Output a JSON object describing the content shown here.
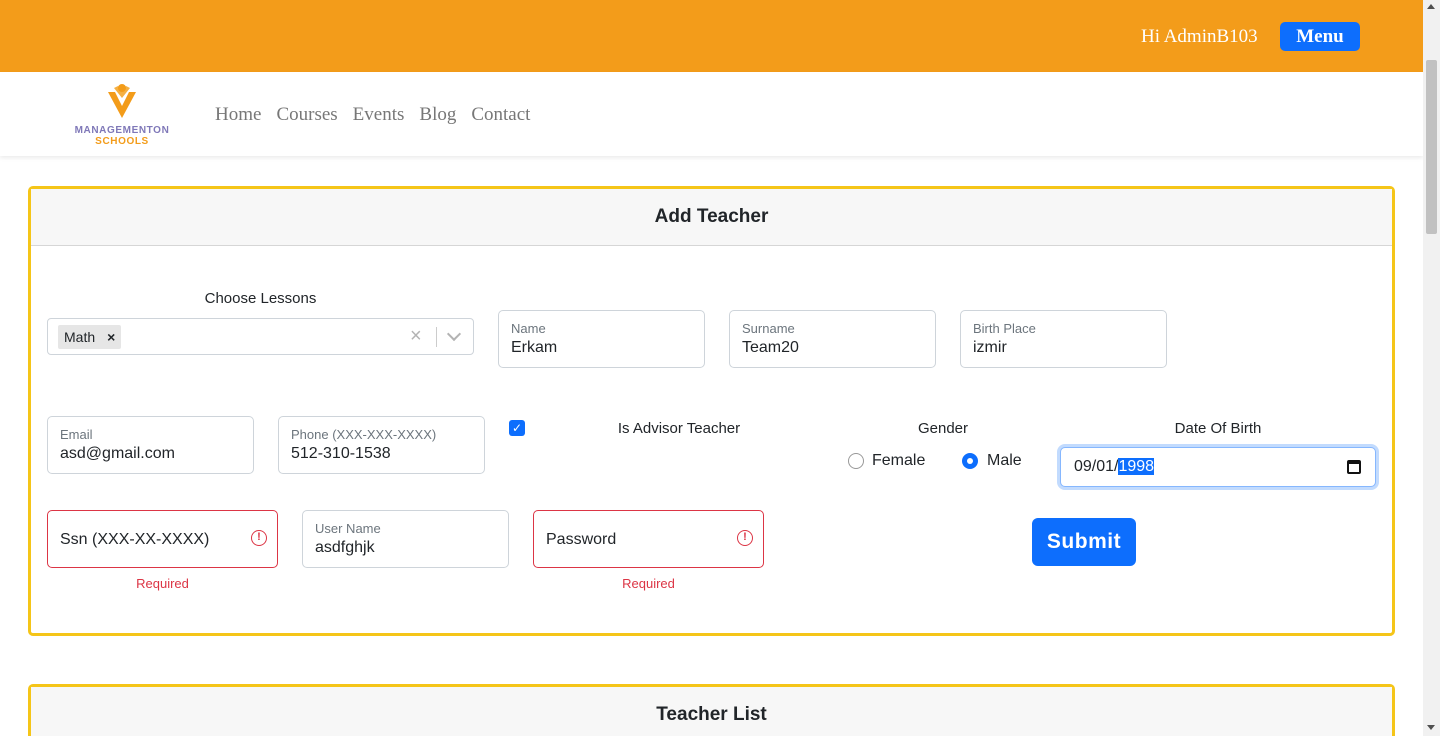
{
  "topbar": {
    "greeting": "Hi AdminB103",
    "menu_label": "Menu"
  },
  "logo": {
    "line1": "MANAGEMENTON",
    "line2": "SCHOOLS"
  },
  "nav": {
    "items": [
      "Home",
      "Courses",
      "Events",
      "Blog",
      "Contact"
    ]
  },
  "form": {
    "title": "Add Teacher",
    "lessons": {
      "label": "Choose Lessons",
      "selected": [
        "Math"
      ],
      "remove_glyph": "×",
      "clear_glyph": "×"
    },
    "name": {
      "label": "Name",
      "value": "Erkam"
    },
    "surname": {
      "label": "Surname",
      "value": "Team20"
    },
    "birth_place": {
      "label": "Birth Place",
      "value": "izmir"
    },
    "email": {
      "label": "Email",
      "value": "asd@gmail.com"
    },
    "phone": {
      "label": "Phone (XXX-XXX-XXXX)",
      "value": "512-310-1538"
    },
    "advisor": {
      "label": "Is Advisor Teacher",
      "checked": true,
      "check_glyph": "✓"
    },
    "gender": {
      "label": "Gender",
      "options": [
        "Female",
        "Male"
      ],
      "selected": "Male"
    },
    "dob": {
      "label": "Date Of Birth",
      "value_prefix": "09/01/",
      "value_selected": "1998"
    },
    "ssn": {
      "placeholder": "Ssn (XXX-XX-XXXX)",
      "error": "Required",
      "error_glyph": "!"
    },
    "username": {
      "label": "User Name",
      "value": "asdfghjk"
    },
    "password": {
      "placeholder": "Password",
      "error": "Required",
      "error_glyph": "!"
    },
    "submit_label": "Submit"
  },
  "list": {
    "title": "Teacher List"
  },
  "colors": {
    "topbar": "#f39c1a",
    "primary": "#0d6efd",
    "card_border": "#f5c518",
    "error": "#dc3545"
  }
}
